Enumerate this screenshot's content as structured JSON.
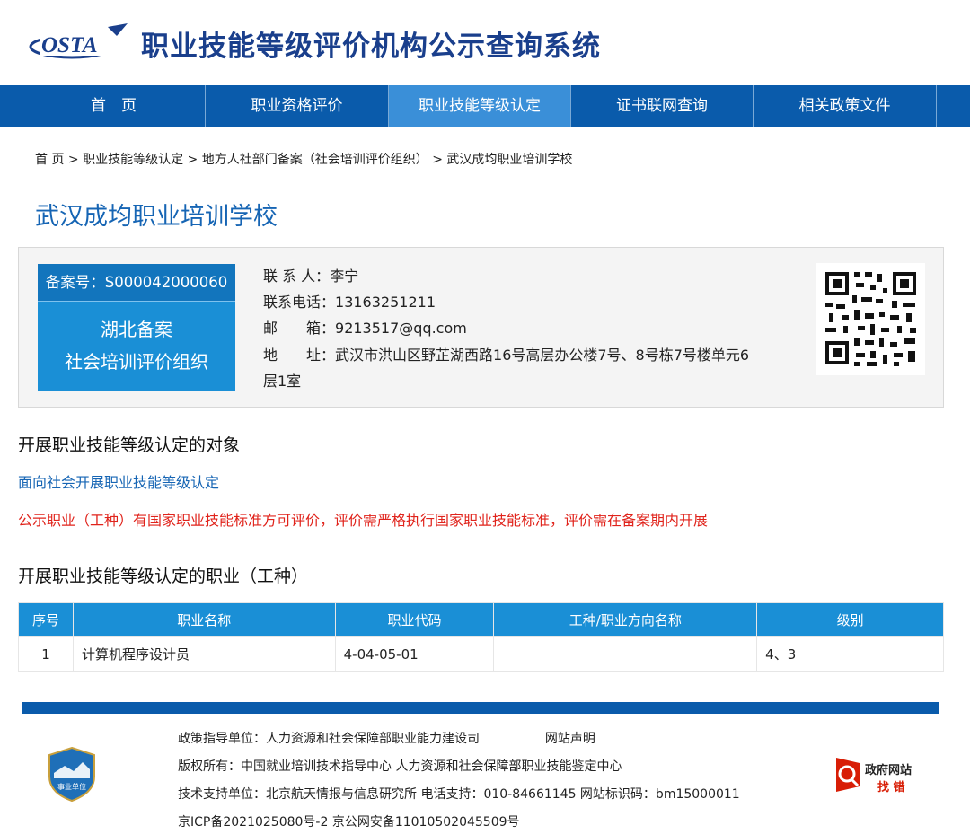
{
  "header": {
    "logo_text": "OSTA",
    "site_title": "职业技能等级评价机构公示查询系统"
  },
  "nav": {
    "items": [
      {
        "label": "首　页"
      },
      {
        "label": "职业资格评价"
      },
      {
        "label": "职业技能等级认定"
      },
      {
        "label": "证书联网查询"
      },
      {
        "label": "相关政策文件"
      }
    ],
    "active_index": 2
  },
  "breadcrumb": {
    "items": [
      "首 页",
      "职业技能等级认定",
      "地方人社部门备案（社会培训评价组织）",
      "武汉成均职业培训学校"
    ],
    "separator": ">"
  },
  "org": {
    "name": "武汉成均职业培训学校",
    "record_no": "备案号：S000042000060",
    "badge_line1": "湖北备案",
    "badge_line2": "社会培训评价组织",
    "contact_person_label": "联 系 人：",
    "contact_person": "李宁",
    "phone_label": "联系电话：",
    "phone": "13163251211",
    "email_label": "邮　　箱：",
    "email": "9213517@qq.com",
    "address_label": "地　　址：",
    "address_line1": "武汉市洪山区野芷湖西路16号高层办公楼7号、8号栋7号楼单元6",
    "address_line2": "层1室",
    "qr_icon": "qr-code-icon"
  },
  "sections": {
    "target_heading": "开展职业技能等级认定的对象",
    "target_text": "面向社会开展职业技能等级认定",
    "notice_text": "公示职业（工种）有国家职业技能标准方可评价，评价需严格执行国家职业技能标准，评价需在备案期内开展",
    "occupation_heading": "开展职业技能等级认定的职业（工种）"
  },
  "table": {
    "headers": [
      "序号",
      "职业名称",
      "职业代码",
      "工种/职业方向名称",
      "级别"
    ],
    "rows": [
      [
        "1",
        "计算机程序设计员",
        "4-04-05-01",
        "",
        "4、3"
      ]
    ]
  },
  "footer": {
    "line1": "政策指导单位：人力资源和社会保障部职业能力建设司",
    "statement_link": "网站声明",
    "line2": "版权所有：中国就业培训技术指导中心  人力资源和社会保障部职业技能鉴定中心",
    "line3": "技术支持单位：北京航天情报与信息研究所   电话支持：010-84661145   网站标识码：bm15000011",
    "line4": "京ICP备2021025080号-2     京公网安备11010502045509号",
    "emblem_text": "事业单位",
    "gov_badge_line1": "政府网站",
    "gov_badge_line2": "找 错"
  },
  "colors": {
    "nav_bg": "#0a5bab",
    "nav_active": "#3a8fd8",
    "accent_blue": "#1665b4",
    "badge_blue": "#1a8fd6",
    "notice_red": "#e0231b"
  }
}
